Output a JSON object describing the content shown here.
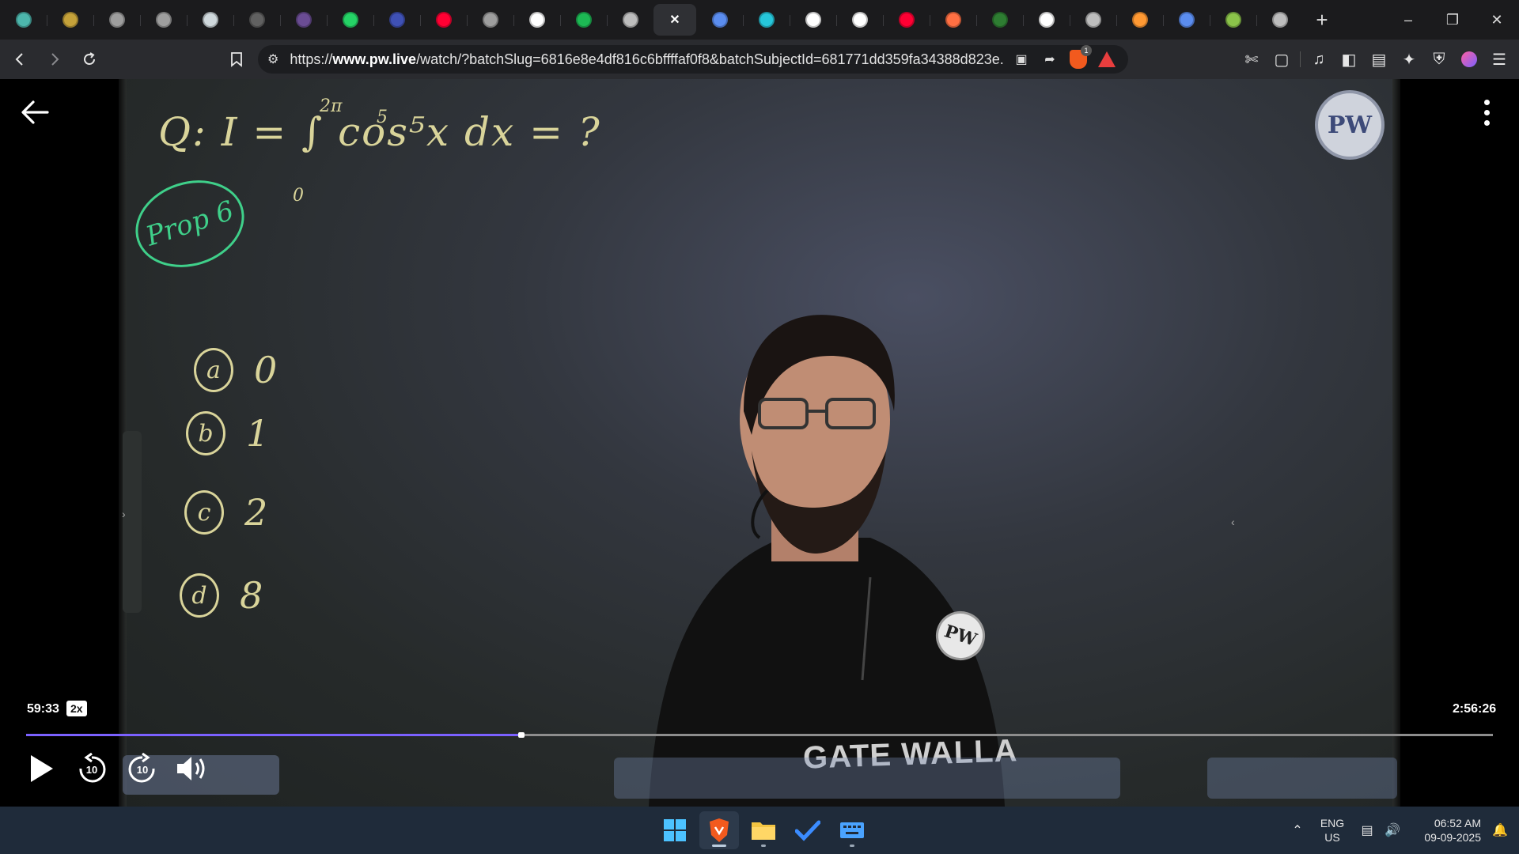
{
  "browser": {
    "tabs": [
      {
        "icon": "app-icon",
        "color": "#4db6ac"
      },
      {
        "icon": "chatgpt-like-icon",
        "color": "#c5a23a"
      },
      {
        "icon": "openai-icon",
        "color": "#9e9e9e"
      },
      {
        "icon": "openai-icon",
        "color": "#9e9e9e"
      },
      {
        "icon": "w3schools-icon",
        "color": "#cfd8dc"
      },
      {
        "icon": "generic-icon",
        "color": "#616161"
      },
      {
        "icon": "purple-app-icon",
        "color": "#6a4c93"
      },
      {
        "icon": "whatsapp-icon",
        "color": "#25d366"
      },
      {
        "icon": "bookmark-app-icon",
        "color": "#3f51b5"
      },
      {
        "icon": "youtube-icon",
        "color": "#ff0033"
      },
      {
        "icon": "on-air-icon",
        "color": "#9e9e9e"
      },
      {
        "icon": "google-icon",
        "color": "#ffffff"
      },
      {
        "icon": "spotify-icon",
        "color": "#1db954"
      },
      {
        "icon": "globe-icon",
        "color": "#bdbdbd"
      },
      {
        "icon": "close-icon",
        "color": "#ffffff",
        "active": true
      },
      {
        "icon": "gemini-icon",
        "color": "#5b8def"
      },
      {
        "icon": "app-icon",
        "color": "#26c6da"
      },
      {
        "icon": "google-icon",
        "color": "#ffffff"
      },
      {
        "icon": "screen-icon",
        "color": "#ffffff"
      },
      {
        "icon": "youtube-icon",
        "color": "#ff0033"
      },
      {
        "icon": "orange-app-icon",
        "color": "#ff7043"
      },
      {
        "icon": "green-app-icon",
        "color": "#2e7d32"
      },
      {
        "icon": "wikipedia-icon",
        "color": "#ffffff"
      },
      {
        "icon": "globe-icon",
        "color": "#bdbdbd"
      },
      {
        "icon": "india-flag-icon",
        "color": "#ff9933"
      },
      {
        "icon": "gemini-icon",
        "color": "#5b8def"
      },
      {
        "icon": "app-icon",
        "color": "#8bc34a"
      },
      {
        "icon": "globe-icon",
        "color": "#bdbdbd"
      }
    ],
    "url_prefix": "https://",
    "url_domain": "www.pw.live",
    "url_rest": "/watch/?batchSlug=6816e8e4df816c6bffffaf0f8&batchSubjectId=681771dd359fa34388d823e...",
    "brave_badge": "1"
  },
  "lecture": {
    "question_prefix": "Q:",
    "question_main": "I = ∫ cos⁵x dx = ?",
    "upper_limit": "2π",
    "lower_limit": "0",
    "exponent": "5",
    "circled_tag": "Prop 6",
    "options": [
      {
        "letter": "a",
        "value": "0"
      },
      {
        "letter": "b",
        "value": "1"
      },
      {
        "letter": "c",
        "value": "2"
      },
      {
        "letter": "d",
        "value": "8"
      }
    ],
    "logo_text": "PW",
    "shirt_text": "GATE WALLA"
  },
  "player": {
    "current_time": "59:33",
    "speed": "2x",
    "total_time": "2:56:26",
    "progress_fraction": 0.3375,
    "rewind_label": "10",
    "forward_label": "10",
    "accent": "#7b61ff"
  },
  "taskbar": {
    "lang_top": "ENG",
    "lang_bottom": "US",
    "time": "06:52 AM",
    "date": "09-09-2025"
  }
}
